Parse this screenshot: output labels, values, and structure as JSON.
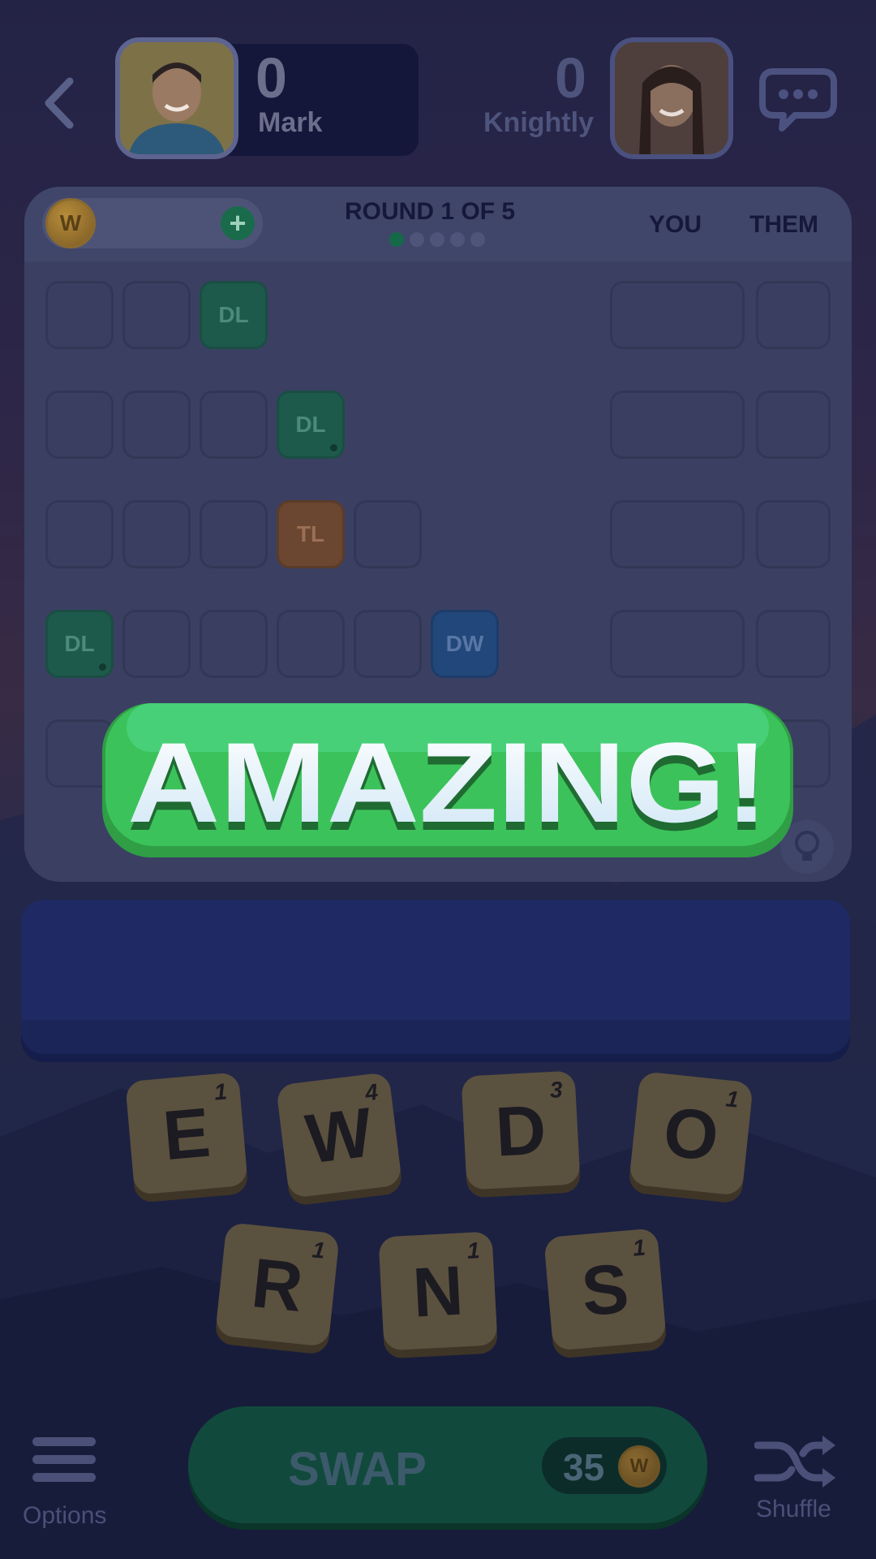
{
  "players": {
    "me": {
      "score": "0",
      "name": "Mark"
    },
    "opponent": {
      "score": "0",
      "name": "Knightly"
    }
  },
  "header": {
    "round_label": "ROUND 1 OF 5",
    "round_current": 1,
    "round_total": 5,
    "col_you": "YOU",
    "col_them": "THEM",
    "coin_glyph": "W",
    "plus_glyph": "+"
  },
  "board": {
    "rows": [
      {
        "cells": [
          "",
          "",
          "DL"
        ]
      },
      {
        "cells": [
          "",
          "",
          "",
          "DL"
        ]
      },
      {
        "cells": [
          "",
          "",
          "",
          "TL",
          ""
        ]
      },
      {
        "cells": [
          "DL",
          "",
          "",
          "",
          "",
          "DW"
        ]
      },
      {
        "cells": [
          "",
          "",
          "",
          "",
          "",
          "",
          ""
        ]
      }
    ]
  },
  "banner": {
    "text": "AMAZING!"
  },
  "rack": {
    "tiles": [
      {
        "letter": "E",
        "points": "1"
      },
      {
        "letter": "W",
        "points": "4"
      },
      {
        "letter": "D",
        "points": "3"
      },
      {
        "letter": "O",
        "points": "1"
      },
      {
        "letter": "R",
        "points": "1"
      },
      {
        "letter": "N",
        "points": "1"
      },
      {
        "letter": "S",
        "points": "1"
      }
    ]
  },
  "controls": {
    "options_label": "Options",
    "swap_label": "SWAP",
    "swap_cost": "35",
    "swap_coin_glyph": "W",
    "shuffle_label": "Shuffle"
  },
  "colors": {
    "dl": "#1e5a4c",
    "tl": "#6b4630",
    "dw": "#22477a",
    "banner_green": "#3cc25a",
    "swap_green": "#114a3c"
  }
}
